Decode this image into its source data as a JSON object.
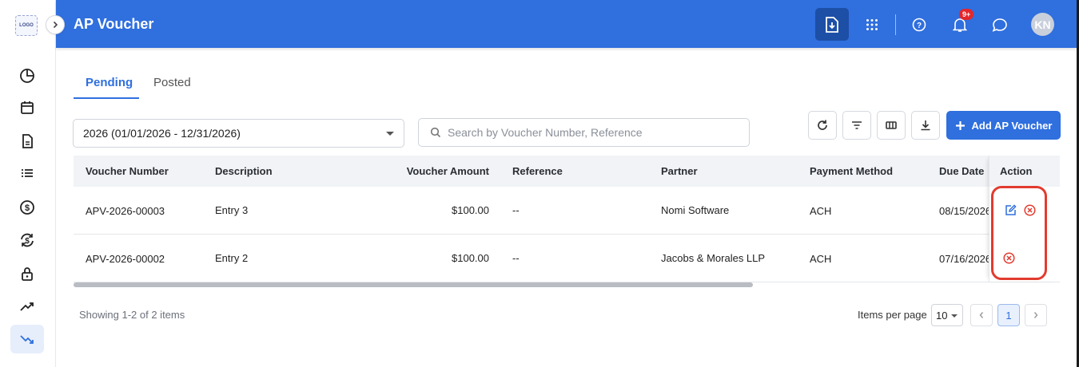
{
  "app": {
    "title": "AP Voucher",
    "logo_text": "LOGO"
  },
  "header": {
    "notification_badge": "9+",
    "avatar_initials": "KN",
    "colors": {
      "primary": "#2f6fde",
      "export_button": "#1d4fa6",
      "badge": "#e5262b"
    }
  },
  "sidebar": {
    "items": [
      {
        "icon": "dashboard-pie-icon"
      },
      {
        "icon": "calendar-icon"
      },
      {
        "icon": "document-icon"
      },
      {
        "icon": "list-icon"
      },
      {
        "icon": "dollar-icon"
      },
      {
        "icon": "dollar-exchange-icon"
      },
      {
        "icon": "lock-icon"
      },
      {
        "icon": "trending-up-icon"
      },
      {
        "icon": "trending-down-icon",
        "active": true
      }
    ]
  },
  "tabs": [
    {
      "label": "Pending",
      "active": true
    },
    {
      "label": "Posted",
      "active": false
    }
  ],
  "filters": {
    "year_selected": "2026 (01/01/2026 - 12/31/2026)",
    "search_placeholder": "Search by Voucher Number, Reference"
  },
  "toolbar": {
    "add_label": "Add AP Voucher"
  },
  "table": {
    "columns": [
      "Voucher Number",
      "Description",
      "Voucher Amount",
      "Reference",
      "Partner",
      "Payment Method",
      "Due Date",
      "Action"
    ],
    "rows": [
      {
        "voucher_number": "APV-2026-00003",
        "description": "Entry 3",
        "amount": "$100.00",
        "reference": "--",
        "partner": "Nomi Software",
        "payment_method": "ACH",
        "due_date": "08/15/2026",
        "actions": [
          "edit",
          "delete"
        ]
      },
      {
        "voucher_number": "APV-2026-00002",
        "description": "Entry 2",
        "amount": "$100.00",
        "reference": "--",
        "partner": "Jacobs & Morales LLP",
        "payment_method": "ACH",
        "due_date": "07/16/2026",
        "actions": [
          "delete"
        ]
      }
    ]
  },
  "pagination": {
    "showing": "Showing 1-2 of 2 items",
    "items_per_page_label": "Items per page",
    "items_per_page": "10",
    "current_page": "1"
  }
}
